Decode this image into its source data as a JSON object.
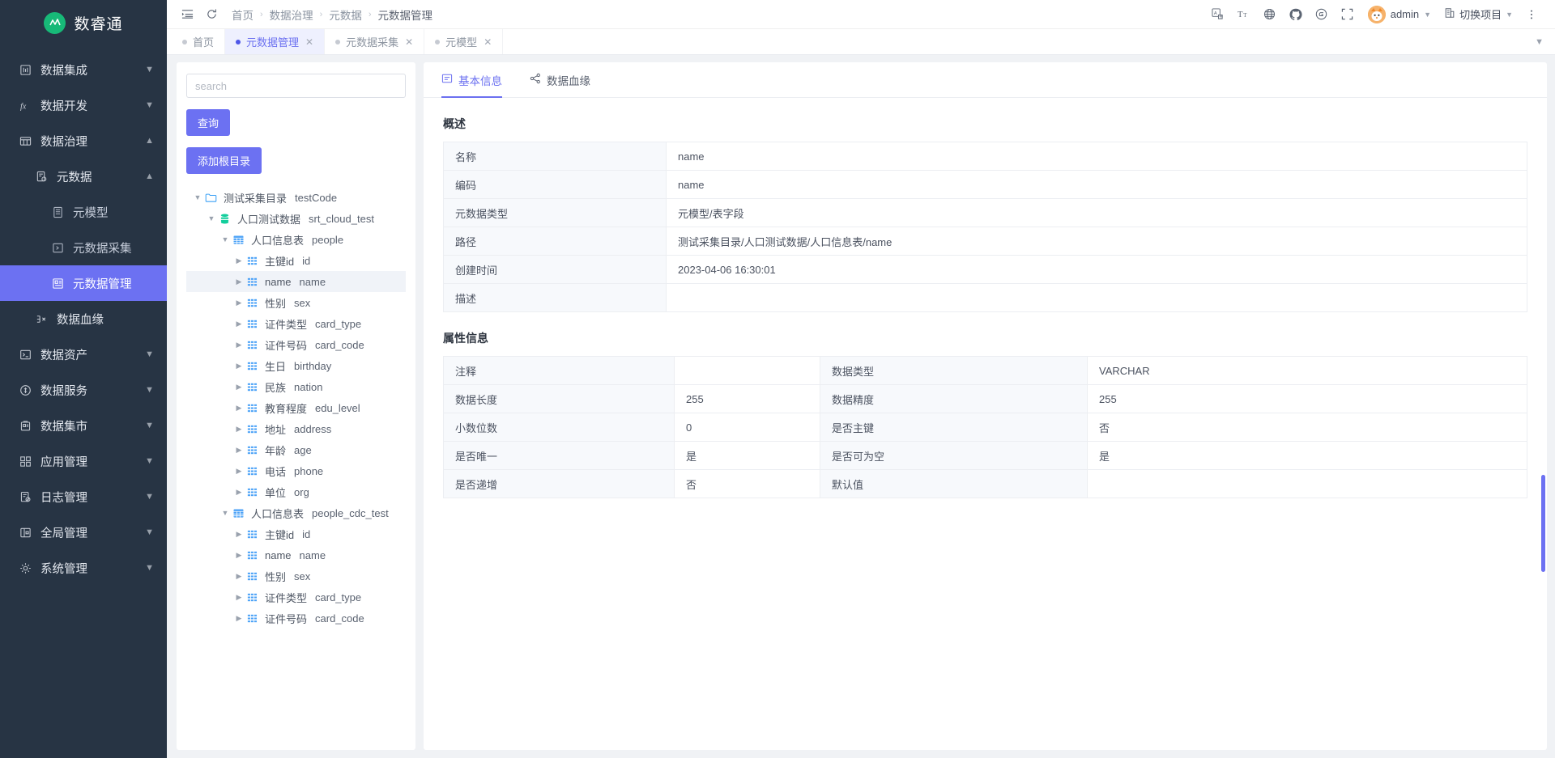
{
  "brand": {
    "name": "数睿通",
    "logo_icon": "brand-logo-icon"
  },
  "sidebar": {
    "items": [
      {
        "label": "数据集成",
        "icon": "integration-icon",
        "level": 1,
        "caret": "chevron-down-icon",
        "active": false
      },
      {
        "label": "数据开发",
        "icon": "fx-icon",
        "level": 1,
        "caret": "chevron-down-icon",
        "active": false
      },
      {
        "label": "数据治理",
        "icon": "grid-icon",
        "level": 1,
        "caret": "chevron-up-icon",
        "active": false
      },
      {
        "label": "元数据",
        "icon": "metadata-icon",
        "level": 2,
        "caret": "chevron-up-icon",
        "active": false
      },
      {
        "label": "元模型",
        "icon": "model-icon",
        "level": 3,
        "caret": "",
        "active": false
      },
      {
        "label": "元数据采集",
        "icon": "collect-icon",
        "level": 3,
        "caret": "",
        "active": false
      },
      {
        "label": "元数据管理",
        "icon": "manage-icon",
        "level": 3,
        "caret": "",
        "active": true
      },
      {
        "label": "数据血缘",
        "icon": "lineage-icon",
        "level": 2,
        "caret": "",
        "active": false
      },
      {
        "label": "数据资产",
        "icon": "asset-icon",
        "level": 1,
        "caret": "chevron-down-icon",
        "active": false
      },
      {
        "label": "数据服务",
        "icon": "service-icon",
        "level": 1,
        "caret": "chevron-down-icon",
        "active": false
      },
      {
        "label": "数据集市",
        "icon": "market-icon",
        "level": 1,
        "caret": "chevron-down-icon",
        "active": false
      },
      {
        "label": "应用管理",
        "icon": "app-icon",
        "level": 1,
        "caret": "chevron-down-icon",
        "active": false
      },
      {
        "label": "日志管理",
        "icon": "log-icon",
        "level": 1,
        "caret": "chevron-down-icon",
        "active": false
      },
      {
        "label": "全局管理",
        "icon": "global-icon",
        "level": 1,
        "caret": "chevron-down-icon",
        "active": false
      },
      {
        "label": "系统管理",
        "icon": "gear-icon",
        "level": 1,
        "caret": "chevron-down-icon",
        "active": false
      }
    ]
  },
  "topbar": {
    "menu_fold_icon": "menu-fold-icon",
    "refresh_icon": "refresh-icon",
    "breadcrumb": [
      "首页",
      "数据治理",
      "元数据",
      "元数据管理"
    ],
    "right_icons": [
      "translate-icon",
      "font-size-icon",
      "globe-icon",
      "github-icon",
      "gitee-icon",
      "fullscreen-icon"
    ],
    "user": "admin",
    "project_switch": "切换项目",
    "more_icon": "more-vertical-icon"
  },
  "tabs": [
    {
      "label": "首页",
      "active": false,
      "closable": false
    },
    {
      "label": "元数据管理",
      "active": true,
      "closable": true
    },
    {
      "label": "元数据采集",
      "active": false,
      "closable": true
    },
    {
      "label": "元模型",
      "active": false,
      "closable": true
    }
  ],
  "tree_panel": {
    "search_placeholder": "search",
    "search_value": "",
    "query_button": "查询",
    "add_root_button": "添加根目录",
    "nodes": [
      {
        "indent": 0,
        "arrow": "down",
        "icon": "folder-icon",
        "label": "测试采集目录",
        "code": "testCode",
        "selected": false
      },
      {
        "indent": 1,
        "arrow": "down",
        "icon": "database-icon",
        "label": "人口测试数据",
        "code": "srt_cloud_test",
        "selected": false
      },
      {
        "indent": 2,
        "arrow": "down",
        "icon": "table-icon",
        "label": "人口信息表",
        "code": "people",
        "selected": false
      },
      {
        "indent": 3,
        "arrow": "right",
        "icon": "column-icon",
        "label": "主键id",
        "code": "id",
        "selected": false
      },
      {
        "indent": 3,
        "arrow": "right",
        "icon": "column-icon",
        "label": "name",
        "code": "name",
        "selected": true
      },
      {
        "indent": 3,
        "arrow": "right",
        "icon": "column-icon",
        "label": "性别",
        "code": "sex",
        "selected": false
      },
      {
        "indent": 3,
        "arrow": "right",
        "icon": "column-icon",
        "label": "证件类型",
        "code": "card_type",
        "selected": false
      },
      {
        "indent": 3,
        "arrow": "right",
        "icon": "column-icon",
        "label": "证件号码",
        "code": "card_code",
        "selected": false
      },
      {
        "indent": 3,
        "arrow": "right",
        "icon": "column-icon",
        "label": "生日",
        "code": "birthday",
        "selected": false
      },
      {
        "indent": 3,
        "arrow": "right",
        "icon": "column-icon",
        "label": "民族",
        "code": "nation",
        "selected": false
      },
      {
        "indent": 3,
        "arrow": "right",
        "icon": "column-icon",
        "label": "教育程度",
        "code": "edu_level",
        "selected": false
      },
      {
        "indent": 3,
        "arrow": "right",
        "icon": "column-icon",
        "label": "地址",
        "code": "address",
        "selected": false
      },
      {
        "indent": 3,
        "arrow": "right",
        "icon": "column-icon",
        "label": "年龄",
        "code": "age",
        "selected": false
      },
      {
        "indent": 3,
        "arrow": "right",
        "icon": "column-icon",
        "label": "电话",
        "code": "phone",
        "selected": false
      },
      {
        "indent": 3,
        "arrow": "right",
        "icon": "column-icon",
        "label": "单位",
        "code": "org",
        "selected": false
      },
      {
        "indent": 2,
        "arrow": "down",
        "icon": "table-icon",
        "label": "人口信息表",
        "code": "people_cdc_test",
        "selected": false
      },
      {
        "indent": 3,
        "arrow": "right",
        "icon": "column-icon",
        "label": "主键id",
        "code": "id",
        "selected": false
      },
      {
        "indent": 3,
        "arrow": "right",
        "icon": "column-icon",
        "label": "name",
        "code": "name",
        "selected": false
      },
      {
        "indent": 3,
        "arrow": "right",
        "icon": "column-icon",
        "label": "性别",
        "code": "sex",
        "selected": false
      },
      {
        "indent": 3,
        "arrow": "right",
        "icon": "column-icon",
        "label": "证件类型",
        "code": "card_type",
        "selected": false
      },
      {
        "indent": 3,
        "arrow": "right",
        "icon": "column-icon",
        "label": "证件号码",
        "code": "card_code",
        "selected": false
      }
    ]
  },
  "detail": {
    "tabs": [
      {
        "label": "基本信息",
        "icon": "info-panel-icon",
        "active": true
      },
      {
        "label": "数据血缘",
        "icon": "share-icon",
        "active": false
      }
    ],
    "overview_title": "概述",
    "overview_rows": [
      {
        "label": "名称",
        "value": "name"
      },
      {
        "label": "编码",
        "value": "name"
      },
      {
        "label": "元数据类型",
        "value": "元模型/表字段"
      },
      {
        "label": "路径",
        "value": "测试采集目录/人口测试数据/人口信息表/name"
      },
      {
        "label": "创建时间",
        "value": "2023-04-06 16:30:01"
      },
      {
        "label": "描述",
        "value": ""
      }
    ],
    "attributes_title": "属性信息",
    "attribute_rows": [
      {
        "label1": "注释",
        "value1": "",
        "label2": "数据类型",
        "value2": "VARCHAR"
      },
      {
        "label1": "数据长度",
        "value1": "255",
        "label2": "数据精度",
        "value2": "255"
      },
      {
        "label1": "小数位数",
        "value1": "0",
        "label2": "是否主键",
        "value2": "否"
      },
      {
        "label1": "是否唯一",
        "value1": "是",
        "label2": "是否可为空",
        "value2": "是"
      },
      {
        "label1": "是否递增",
        "value1": "否",
        "label2": "默认值",
        "value2": ""
      }
    ]
  },
  "colors": {
    "accent": "#6c71f2",
    "sidebar_bg": "#273444",
    "tab_active_bg": "#eef0fe",
    "brand_green": "#17b978"
  }
}
